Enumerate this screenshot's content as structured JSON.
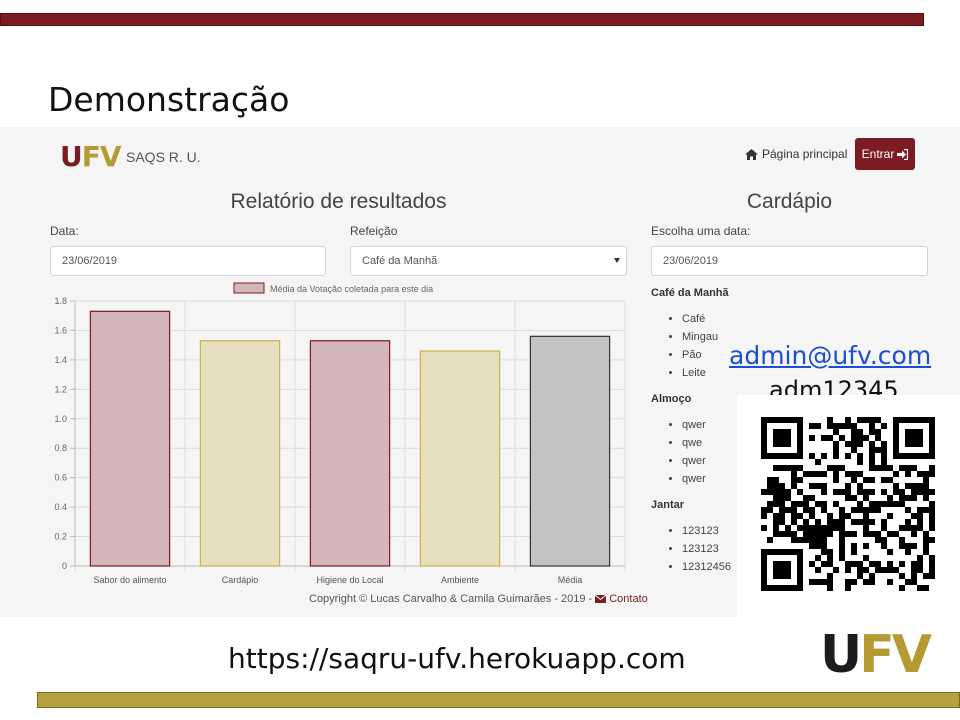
{
  "slide": {
    "title": "Demonstração",
    "email": "admin@ufv.com",
    "password": "adm12345",
    "url": "https://saqru-ufv.herokuapp.com",
    "logo_u": "U",
    "logo_fv": "FV",
    "colors": {
      "primary": "#7b1c22",
      "gold": "#b5a140"
    }
  },
  "app": {
    "brand": {
      "logo_u": "U",
      "logo_fv": "FV",
      "name": "SAQS R. U."
    },
    "nav": {
      "home_label": "Página principal",
      "home_icon": "home-icon",
      "login_label": "Entrar",
      "login_icon": "sign-in-icon"
    },
    "report": {
      "heading": "Relatório de resultados",
      "date_label": "Data:",
      "date_value": "23/06/2019",
      "meal_label": "Refeição",
      "meal_value": "Café da Manhã"
    },
    "menu": {
      "heading": "Cardápio",
      "date_label": "Escolha uma data:",
      "date_value": "23/06/2019",
      "sections": [
        {
          "title": "Café da Manhã",
          "items": [
            "Café",
            "Mingau",
            "Pão",
            "Leite"
          ]
        },
        {
          "title": "Almoço",
          "items": [
            "qwer",
            "qwe",
            "qwer",
            "qwer"
          ]
        },
        {
          "title": "Jantar",
          "items": [
            "123123",
            "123123",
            "12312456"
          ]
        }
      ]
    },
    "footer": {
      "text": "Copyright © Lucas Carvalho & Camila Guimarães - 2019 -",
      "contact_label": "Contato",
      "contact_icon": "envelope-icon"
    }
  },
  "chart_data": {
    "type": "bar",
    "legend": "Média da Votação coletada para este dia",
    "categories": [
      "Sabor do alimento",
      "Cardápio",
      "Higiene do Local",
      "Ambiente",
      "Média"
    ],
    "values": [
      1.73,
      1.53,
      1.53,
      1.46,
      1.56
    ],
    "bar_colors": [
      "#d4b5b9",
      "#e6dfc0",
      "#d4b5b9",
      "#e6dfc0",
      "#c3c3c4"
    ],
    "border_colors": [
      "#7b1c22",
      "#c9b24a",
      "#7b1c22",
      "#c9b24a",
      "#333333"
    ],
    "ylim": [
      0,
      1.8
    ],
    "yticks": [
      "0",
      "0.2",
      "0.4",
      "0.6",
      "0.8",
      "1.0",
      "1.2",
      "1.4",
      "1.6",
      "1.8"
    ],
    "grid": true,
    "legend_position": "top"
  }
}
